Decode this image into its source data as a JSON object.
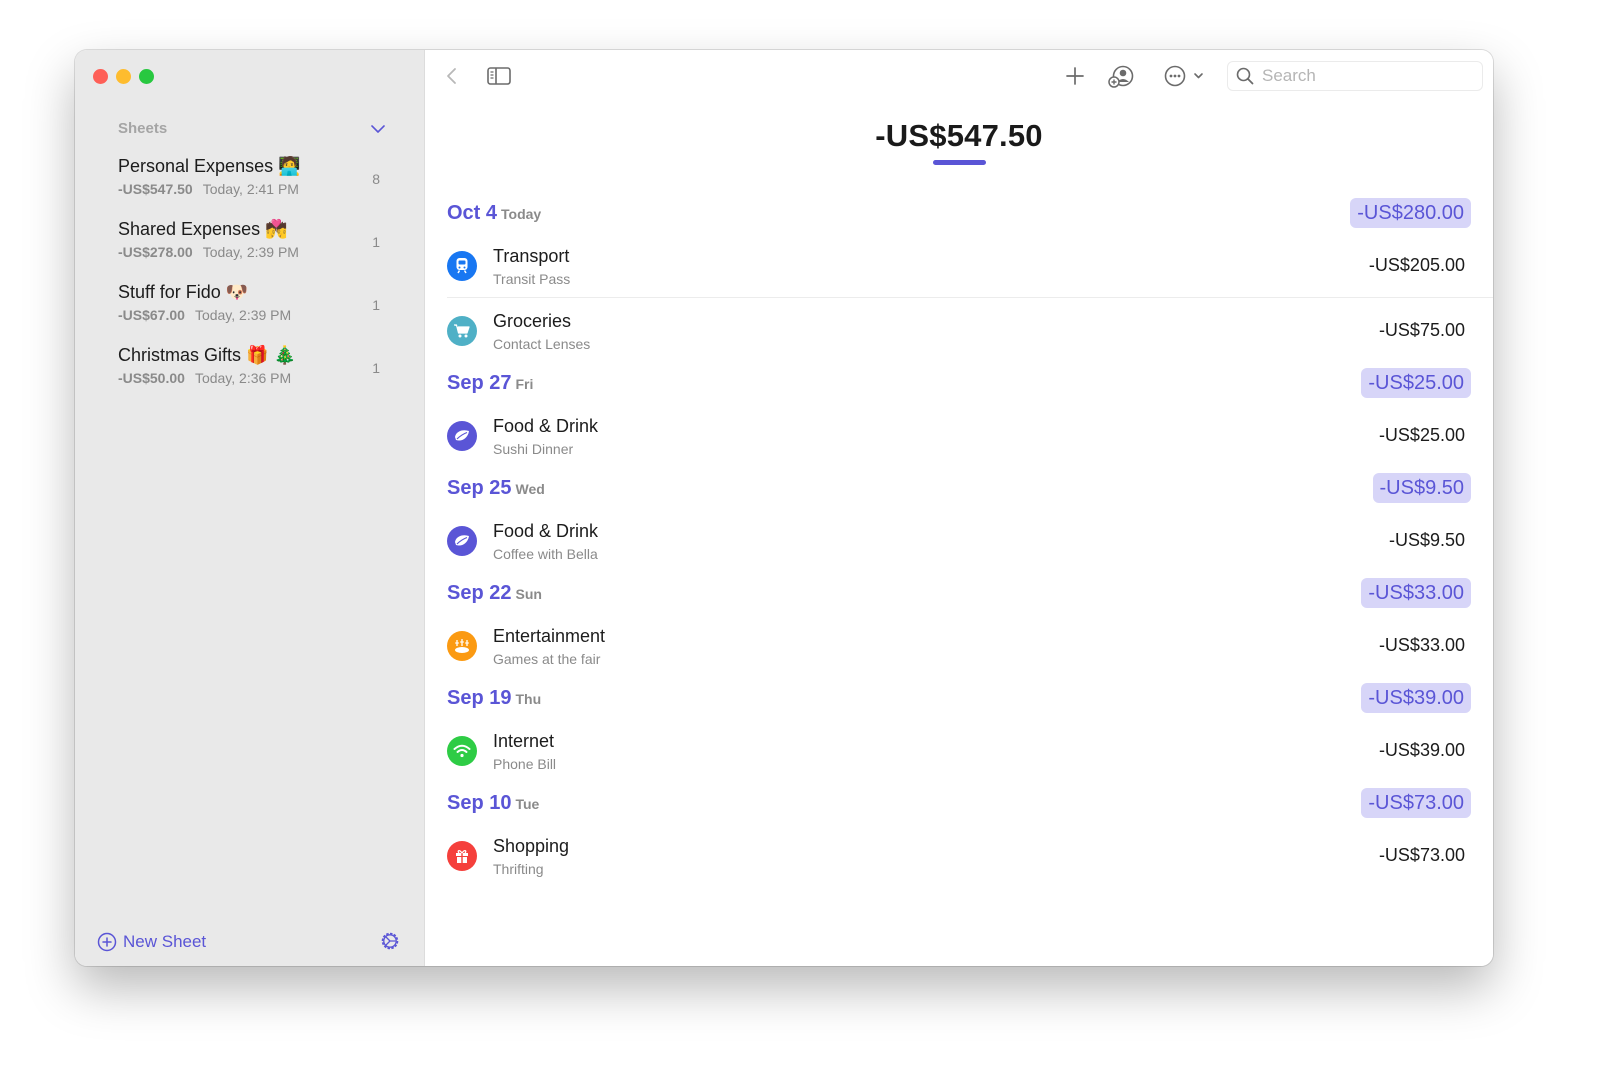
{
  "window": {
    "controls": [
      "close",
      "minimize",
      "maximize"
    ]
  },
  "sidebar": {
    "section_title": "Sheets",
    "sheets": [
      {
        "name": "Personal Expenses",
        "emoji": "🧑‍💻",
        "amount": "-US$547.50",
        "time": "Today, 2:41 PM",
        "count": "8"
      },
      {
        "name": "Shared Expenses",
        "emoji": "💏",
        "amount": "-US$278.00",
        "time": "Today, 2:39 PM",
        "count": "1"
      },
      {
        "name": "Stuff for Fido",
        "emoji": "🐶",
        "amount": "-US$67.00",
        "time": "Today, 2:39 PM",
        "count": "1"
      },
      {
        "name": "Christmas Gifts",
        "emoji": "🎁 🎄",
        "amount": "-US$50.00",
        "time": "Today, 2:36 PM",
        "count": "1"
      }
    ],
    "new_sheet_label": "New Sheet"
  },
  "toolbar": {
    "search_placeholder": "Search",
    "search_value": ""
  },
  "main": {
    "total": "-US$547.50",
    "accent_color": "#5a55d6",
    "days": [
      {
        "date": "Oct 4",
        "weekday": "Today",
        "total": "-US$280.00",
        "transactions": [
          {
            "category": "Transport",
            "note": "Transit Pass",
            "amount": "-US$205.00",
            "icon": "train-icon",
            "color": "#1877f2"
          },
          {
            "category": "Groceries",
            "note": "Contact Lenses",
            "amount": "-US$75.00",
            "icon": "cart-icon",
            "color": "#4fb0c6"
          }
        ]
      },
      {
        "date": "Sep 27",
        "weekday": "Fri",
        "total": "-US$25.00",
        "transactions": [
          {
            "category": "Food & Drink",
            "note": "Sushi Dinner",
            "amount": "-US$25.00",
            "icon": "leaf-icon",
            "color": "#5a55d6"
          }
        ]
      },
      {
        "date": "Sep 25",
        "weekday": "Wed",
        "total": "-US$9.50",
        "transactions": [
          {
            "category": "Food & Drink",
            "note": "Coffee with Bella",
            "amount": "-US$9.50",
            "icon": "leaf-icon",
            "color": "#5a55d6"
          }
        ]
      },
      {
        "date": "Sep 22",
        "weekday": "Sun",
        "total": "-US$33.00",
        "transactions": [
          {
            "category": "Entertainment",
            "note": "Games at the fair",
            "amount": "-US$33.00",
            "icon": "bowling-icon",
            "color": "#fb9a12"
          }
        ]
      },
      {
        "date": "Sep 19",
        "weekday": "Thu",
        "total": "-US$39.00",
        "transactions": [
          {
            "category": "Internet",
            "note": "Phone Bill",
            "amount": "-US$39.00",
            "icon": "wifi-icon",
            "color": "#2ecc45"
          }
        ]
      },
      {
        "date": "Sep 10",
        "weekday": "Tue",
        "total": "-US$73.00",
        "transactions": [
          {
            "category": "Shopping",
            "note": "Thrifting",
            "amount": "-US$73.00",
            "icon": "gift-icon",
            "color": "#f5403c"
          }
        ]
      }
    ]
  }
}
